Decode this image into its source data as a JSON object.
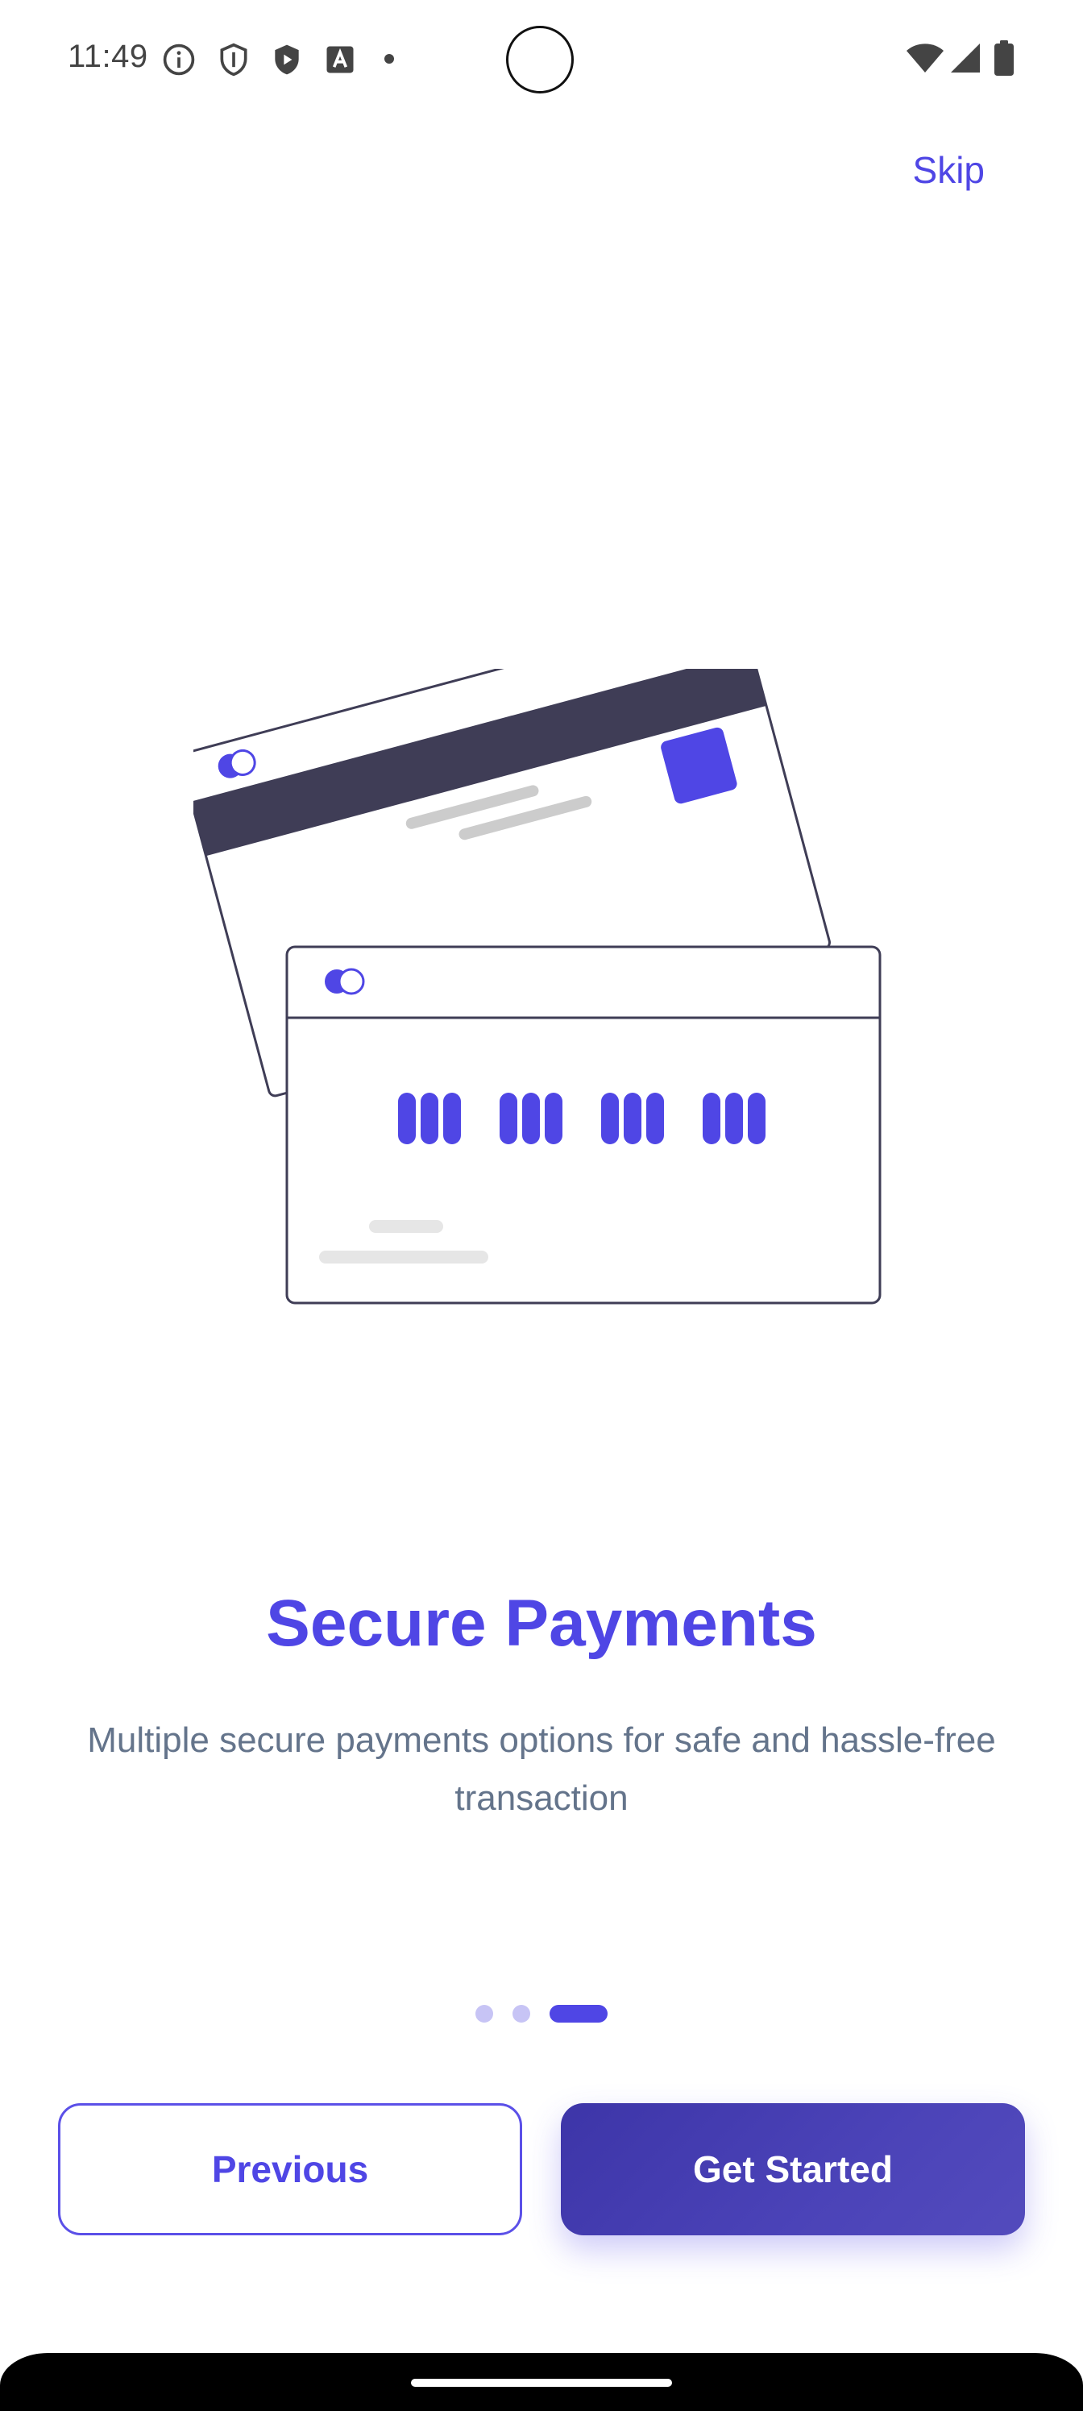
{
  "status_bar": {
    "time": "11:49",
    "left_icons": [
      "info-icon",
      "shield-outline-icon",
      "shield-play-icon",
      "text-a-icon",
      "dot-icon"
    ],
    "right_icons": [
      "wifi-icon",
      "cellular-signal-icon",
      "battery-icon"
    ]
  },
  "header": {
    "skip_label": "Skip"
  },
  "onboarding": {
    "illustration": "credit-cards-illustration",
    "card_number_groups": 4,
    "title": "Secure Payments",
    "description": "Multiple secure payments options for safe and hassle-free transaction"
  },
  "pager": {
    "total_pages": 3,
    "current_page": 3
  },
  "actions": {
    "previous_label": "Previous",
    "primary_label": "Get Started"
  },
  "colors": {
    "accent": "#4f46e5",
    "primary_button": "#3d35a8",
    "text_muted": "#64748b",
    "card_stripe": "#3f3d56"
  }
}
